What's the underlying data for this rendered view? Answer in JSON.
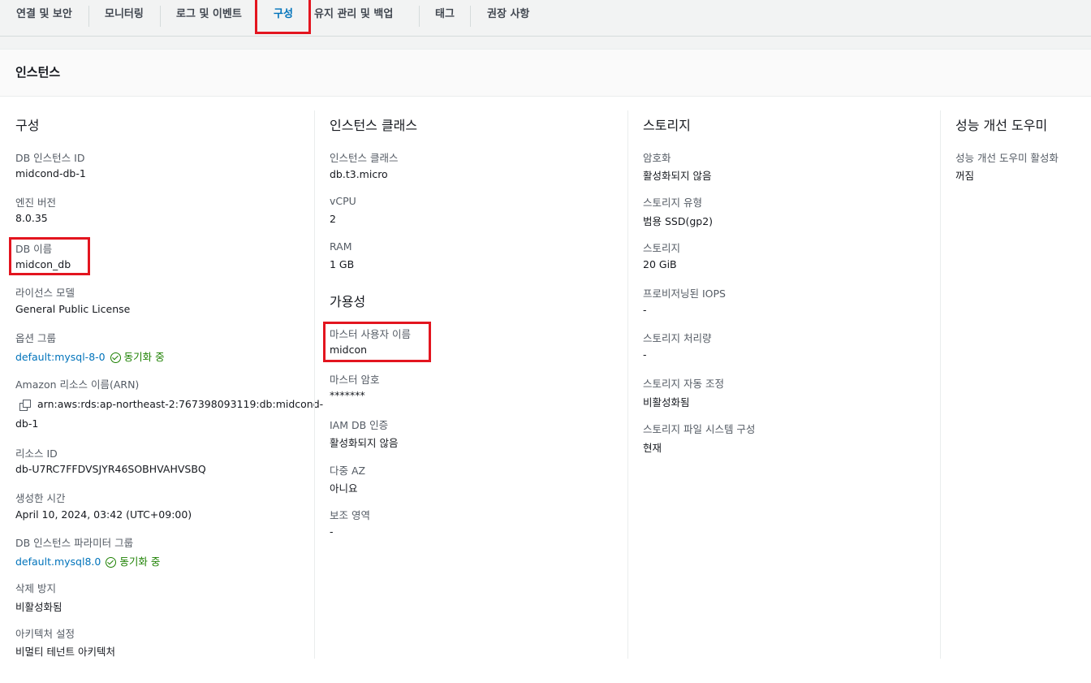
{
  "tabs": [
    {
      "label": "연결 및 보안",
      "active": false
    },
    {
      "label": "모니터링",
      "active": false
    },
    {
      "label": "로그 및 이벤트",
      "active": false
    },
    {
      "label": "구성",
      "active": true
    },
    {
      "label": "유지 관리 및 백업",
      "active": false
    },
    {
      "label": "태그",
      "active": false
    },
    {
      "label": "권장 사항",
      "active": false
    }
  ],
  "panel": {
    "title": "인스턴스"
  },
  "config": {
    "title": "구성",
    "db_instance_id": {
      "label": "DB 인스턴스 ID",
      "value": "midcond-db-1"
    },
    "engine_version": {
      "label": "엔진 버전",
      "value": "8.0.35"
    },
    "db_name": {
      "label": "DB 이름",
      "value": "midcon_db"
    },
    "license_model": {
      "label": "라이선스 모델",
      "value": "General Public License"
    },
    "option_group": {
      "label": "옵션 그룹",
      "value": "default:mysql-8-0",
      "status": "동기화 중"
    },
    "arn": {
      "label": "Amazon 리소스 이름(ARN)",
      "value_line1": "arn:aws:rds:ap-northeast-2:767398093119:db:midcond-",
      "value_line2": "db-1"
    },
    "resource_id": {
      "label": "리소스 ID",
      "value": "db-U7RC7FFDVSJYR46SOBHVAHVSBQ"
    },
    "created_time": {
      "label": "생성한 시간",
      "value": "April 10, 2024, 03:42 (UTC+09:00)"
    },
    "parameter_group": {
      "label": "DB 인스턴스 파라미터 그룹",
      "value": "default.mysql8.0",
      "status": "동기화 중"
    },
    "deletion_protection": {
      "label": "삭제 방지",
      "value": "비활성화됨"
    },
    "architecture": {
      "label": "아키텍처 설정",
      "value": "비멀티 테넌트 아키텍처"
    }
  },
  "instance_class": {
    "title": "인스턴스 클래스",
    "class": {
      "label": "인스턴스 클래스",
      "value": "db.t3.micro"
    },
    "vcpu": {
      "label": "vCPU",
      "value": "2"
    },
    "ram": {
      "label": "RAM",
      "value": "1 GB"
    }
  },
  "availability": {
    "title": "가용성",
    "master_username": {
      "label": "마스터 사용자 이름",
      "value": "midcon"
    },
    "master_password": {
      "label": "마스터 암호",
      "value": "*******"
    },
    "iam_auth": {
      "label": "IAM DB 인증",
      "value": "활성화되지 않음"
    },
    "multi_az": {
      "label": "다중 AZ",
      "value": "아니요"
    },
    "secondary_zone": {
      "label": "보조 영역",
      "value": "-"
    }
  },
  "storage": {
    "title": "스토리지",
    "encryption": {
      "label": "암호화",
      "value": "활성화되지 않음"
    },
    "storage_type": {
      "label": "스토리지 유형",
      "value": "범용 SSD(gp2)"
    },
    "storage": {
      "label": "스토리지",
      "value": "20 GiB"
    },
    "provisioned_iops": {
      "label": "프로비저닝된 IOPS",
      "value": "-"
    },
    "throughput": {
      "label": "스토리지 처리량",
      "value": "-"
    },
    "autoscaling": {
      "label": "스토리지 자동 조정",
      "value": "비활성화됨"
    },
    "file_system": {
      "label": "스토리지 파일 시스템 구성",
      "value": "현재"
    }
  },
  "performance": {
    "title": "성능 개선 도우미",
    "enabled": {
      "label": "성능 개선 도우미 활성화",
      "value": "꺼짐"
    }
  },
  "colors": {
    "accent": "#0073bb",
    "success": "#1d8102",
    "highlight": "#e3151f"
  },
  "icons": {
    "copy": "copy-icon",
    "status": "check-circle-icon"
  }
}
